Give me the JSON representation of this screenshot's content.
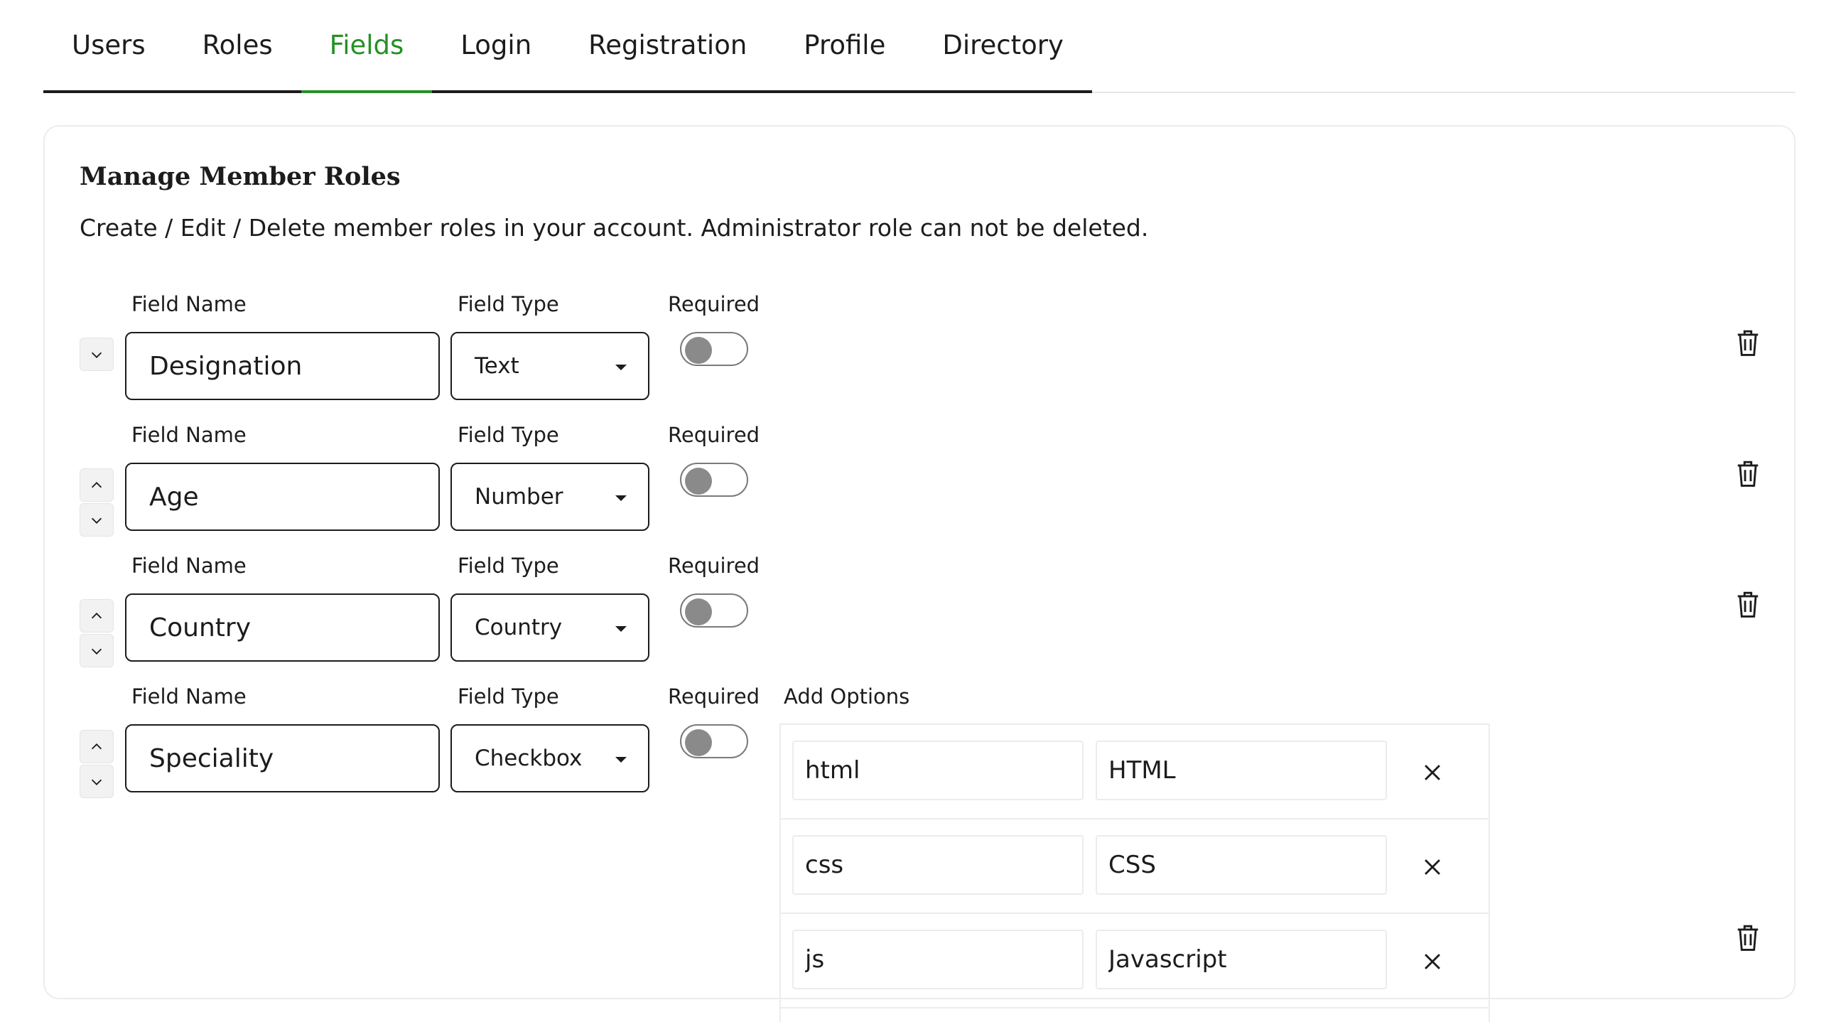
{
  "tabs": [
    {
      "label": "Users",
      "active": false
    },
    {
      "label": "Roles",
      "active": false
    },
    {
      "label": "Fields",
      "active": true
    },
    {
      "label": "Login",
      "active": false
    },
    {
      "label": "Registration",
      "active": false
    },
    {
      "label": "Profile",
      "active": false
    },
    {
      "label": "Directory",
      "active": false
    }
  ],
  "colors": {
    "accent": "#249124",
    "text": "#1c1c1c",
    "border": "#ececec"
  },
  "card": {
    "title": "Manage Member Roles",
    "description": "Create / Edit / Delete member roles in your account. Administrator role can not be deleted."
  },
  "labels": {
    "field_name": "Field Name",
    "field_type": "Field Type",
    "required": "Required",
    "add_options": "Add Options"
  },
  "fields": [
    {
      "name": "Designation",
      "type": "Text",
      "required": false,
      "can_move_up": false,
      "can_move_down": true
    },
    {
      "name": "Age",
      "type": "Number",
      "required": false,
      "can_move_up": true,
      "can_move_down": true
    },
    {
      "name": "Country",
      "type": "Country",
      "required": false,
      "can_move_up": true,
      "can_move_down": true
    },
    {
      "name": "Speciality",
      "type": "Checkbox",
      "required": false,
      "can_move_up": true,
      "can_move_down": true
    }
  ],
  "options": [
    {
      "key": "html",
      "value": "HTML"
    },
    {
      "key": "css",
      "value": "CSS"
    },
    {
      "key": "js",
      "value": "Javascript"
    }
  ],
  "icons": {
    "move_up": "chevron-up-icon",
    "move_down": "chevron-down-icon",
    "delete": "trash-icon",
    "remove_option": "close-icon",
    "select_caret": "caret-down-icon"
  }
}
